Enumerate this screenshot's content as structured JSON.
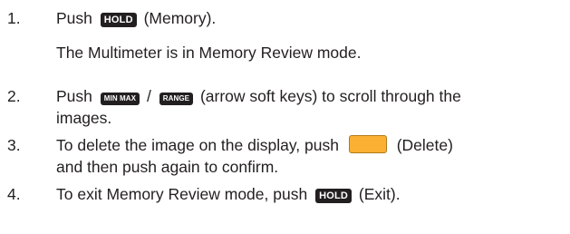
{
  "steps": [
    {
      "number": "1.",
      "t1": "Push",
      "key1": "HOLD",
      "t2": "(Memory).",
      "note": "The Multimeter is in Memory Review mode."
    },
    {
      "number": "2.",
      "t1": "Push",
      "key1": "MIN MAX",
      "slash": "/",
      "key2": "RANGE",
      "t2": "(arrow soft keys) to scroll through the",
      "line2": "images."
    },
    {
      "number": "3.",
      "t1": "To delete the image on the display, push",
      "t2": "(Delete)",
      "line2": "and then push again to confirm."
    },
    {
      "number": "4.",
      "t1": "To exit Memory Review mode, push",
      "key1": "HOLD",
      "t2": "(Exit)."
    }
  ],
  "colors": {
    "text": "#231f20",
    "key_bg": "#231f20",
    "soft_key": "#fbb034"
  },
  "icons": {
    "delete_soft_key": "orange-soft-key-icon"
  }
}
